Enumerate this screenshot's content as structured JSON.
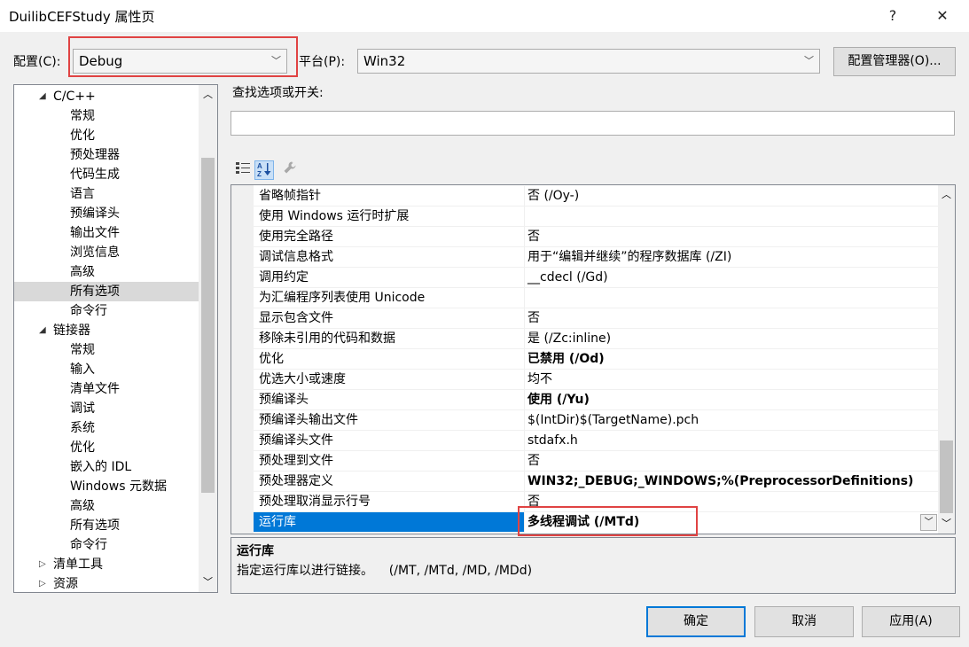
{
  "window": {
    "title": "DuilibCEFStudy 属性页",
    "help_label": "?",
    "close_label": "✕"
  },
  "config": {
    "config_label": "配置(C):",
    "config_value": "Debug",
    "platform_label": "平台(P):",
    "platform_value": "Win32",
    "manager_button": "配置管理器(O)..."
  },
  "tree": {
    "items": [
      {
        "label": "C/C++",
        "expander": "◢"
      },
      {
        "label": "常规"
      },
      {
        "label": "优化"
      },
      {
        "label": "预处理器"
      },
      {
        "label": "代码生成"
      },
      {
        "label": "语言"
      },
      {
        "label": "预编译头"
      },
      {
        "label": "输出文件"
      },
      {
        "label": "浏览信息"
      },
      {
        "label": "高级"
      },
      {
        "label": "所有选项"
      },
      {
        "label": "命令行"
      },
      {
        "label": "链接器",
        "expander": "◢"
      },
      {
        "label": "常规"
      },
      {
        "label": "输入"
      },
      {
        "label": "清单文件"
      },
      {
        "label": "调试"
      },
      {
        "label": "系统"
      },
      {
        "label": "优化"
      },
      {
        "label": "嵌入的 IDL"
      },
      {
        "label": "Windows 元数据"
      },
      {
        "label": "高级"
      },
      {
        "label": "所有选项"
      },
      {
        "label": "命令行"
      },
      {
        "label": "清单工具",
        "expander": "▷"
      },
      {
        "label": "资源",
        "expander": "▷"
      }
    ]
  },
  "search": {
    "label": "查找选项或开关:",
    "value": ""
  },
  "toolbar": {
    "categorized_icon": "categorized-list-icon",
    "sort_icon": "sort-az-icon",
    "property_pages_icon": "wrench-icon"
  },
  "grid": {
    "rows": [
      {
        "name": "省略帧指针",
        "value": "否 (/Oy-)",
        "bold": false
      },
      {
        "name": "使用 Windows 运行时扩展",
        "value": "",
        "bold": false
      },
      {
        "name": "使用完全路径",
        "value": "否",
        "bold": false
      },
      {
        "name": "调试信息格式",
        "value": "用于“编辑并继续”的程序数据库 (/ZI)",
        "bold": false
      },
      {
        "name": "调用约定",
        "value": "__cdecl (/Gd)",
        "bold": false
      },
      {
        "name": "为汇编程序列表使用 Unicode",
        "value": "",
        "bold": false
      },
      {
        "name": "显示包含文件",
        "value": "否",
        "bold": false
      },
      {
        "name": "移除未引用的代码和数据",
        "value": "是 (/Zc:inline)",
        "bold": false
      },
      {
        "name": "优化",
        "value": "已禁用 (/Od)",
        "bold": true
      },
      {
        "name": "优选大小或速度",
        "value": "均不",
        "bold": false
      },
      {
        "name": "预编译头",
        "value": "使用 (/Yu)",
        "bold": true
      },
      {
        "name": "预编译头输出文件",
        "value": "$(IntDir)$(TargetName).pch",
        "bold": false
      },
      {
        "name": "预编译头文件",
        "value": "stdafx.h",
        "bold": false
      },
      {
        "name": "预处理到文件",
        "value": "否",
        "bold": false
      },
      {
        "name": "预处理器定义",
        "value": "WIN32;_DEBUG;_WINDOWS;%(PreprocessorDefinitions)",
        "bold": true
      },
      {
        "name": "预处理取消显示行号",
        "value": "否",
        "bold": false
      },
      {
        "name": "运行库",
        "value": "多线程调试 (/MTd)",
        "bold": true,
        "selected": true
      }
    ]
  },
  "description": {
    "title": "运行库",
    "text": "指定运行库以进行链接。    (/MT, /MTd, /MD, /MDd)"
  },
  "buttons": {
    "ok": "确定",
    "cancel": "取消",
    "apply": "应用(A)"
  },
  "colors": {
    "selection": "#0078d7",
    "highlight_box": "#e04343"
  }
}
